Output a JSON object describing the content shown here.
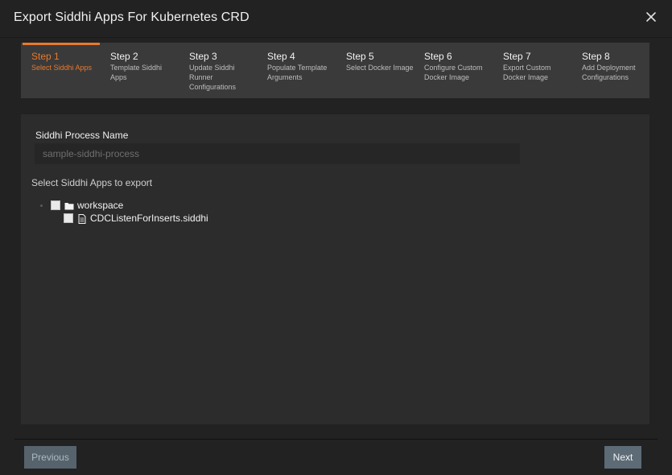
{
  "dialog": {
    "title": "Export Siddhi Apps For Kubernetes CRD",
    "close_icon": "close-icon"
  },
  "steps": [
    {
      "num": "Step 1",
      "label": "Select Siddhi Apps",
      "active": true
    },
    {
      "num": "Step 2",
      "label": "Template Siddhi Apps",
      "active": false
    },
    {
      "num": "Step 3",
      "label": "Update Siddhi Runner Configurations",
      "active": false
    },
    {
      "num": "Step 4",
      "label": "Populate Template Arguments",
      "active": false
    },
    {
      "num": "Step 5",
      "label": "Select Docker Image",
      "active": false
    },
    {
      "num": "Step 6",
      "label": "Configure Custom Docker Image",
      "active": false
    },
    {
      "num": "Step 7",
      "label": "Export Custom Docker Image",
      "active": false
    },
    {
      "num": "Step 8",
      "label": "Add Deployment Configurations",
      "active": false
    }
  ],
  "form": {
    "process_name_label": "Siddhi Process Name",
    "process_name_placeholder": "sample-siddhi-process",
    "process_name_value": "",
    "apps_label": "Select Siddhi Apps to export"
  },
  "tree": {
    "root": {
      "name": "workspace",
      "icon": "folder-icon",
      "checked": false
    },
    "children": [
      {
        "name": "CDCListenForInserts.siddhi",
        "icon": "file-icon",
        "checked": false
      }
    ]
  },
  "footer": {
    "previous_label": "Previous",
    "next_label": "Next"
  },
  "colors": {
    "accent": "#e8792e",
    "button": "#5c6b76"
  }
}
